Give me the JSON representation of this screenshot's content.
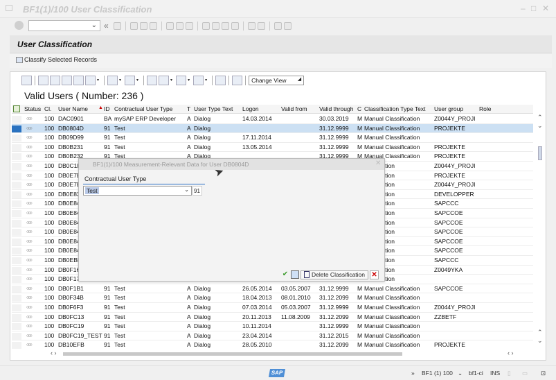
{
  "window": {
    "title": "BF1(1)/100 User Classification",
    "controls": [
      "‒",
      "□",
      "✕"
    ]
  },
  "command_field": {
    "value": ""
  },
  "page": {
    "title": "User Classification",
    "classify_button": "Classify Selected Records"
  },
  "alv": {
    "change_view": "Change View",
    "list_title": "Valid Users ( Number: 236 )"
  },
  "table": {
    "columns": [
      "Status",
      "Cl.",
      "User Name",
      "ID",
      "Contractual User Type",
      "T",
      "User Type Text",
      "Logon",
      "Valid from",
      "Valid through",
      "C",
      "Classification Type Text",
      "User group",
      "Role"
    ],
    "rows": [
      {
        "cl": "100",
        "user": "DAC0901",
        "id": "BA",
        "ctype": "mySAP ERP Developer",
        "t": "A",
        "ttext": "Dialog",
        "logon": "14.03.2014",
        "vfrom": "",
        "vthru": "30.03.2019",
        "c": "M",
        "ctext": "Manual Classification",
        "group": "Z0044Y_PROJI",
        "role": ""
      },
      {
        "cl": "100",
        "user": "DB0804D",
        "id": "91",
        "ctype": "Test",
        "t": "A",
        "ttext": "Dialog",
        "logon": "",
        "vfrom": "",
        "vthru": "31.12.9999",
        "c": "M",
        "ctext": "Manual Classification",
        "group": "PROJEKTE",
        "role": ""
      },
      {
        "cl": "100",
        "user": "DB09D99",
        "id": "91",
        "ctype": "Test",
        "t": "A",
        "ttext": "Dialog",
        "logon": "17.11.2014",
        "vfrom": "",
        "vthru": "31.12.9999",
        "c": "M",
        "ctext": "Manual Classification",
        "group": "",
        "role": ""
      },
      {
        "cl": "100",
        "user": "DB0B231",
        "id": "91",
        "ctype": "Test",
        "t": "A",
        "ttext": "Dialog",
        "logon": "13.05.2014",
        "vfrom": "",
        "vthru": "31.12.9999",
        "c": "M",
        "ctext": "Manual Classification",
        "group": "PROJEKTE",
        "role": ""
      },
      {
        "cl": "100",
        "user": "DB0B232",
        "id": "91",
        "ctype": "Test",
        "t": "A",
        "ttext": "Dialog",
        "logon": "",
        "vfrom": "",
        "vthru": "31.12.9999",
        "c": "M",
        "ctext": "Manual Classification",
        "group": "PROJEKTE",
        "role": ""
      },
      {
        "cl": "100",
        "user": "DB0C1E",
        "id": "",
        "ctype": "",
        "t": "",
        "ttext": "",
        "logon": "",
        "vfrom": "",
        "vthru": "",
        "c": "",
        "ctext": "lassification",
        "group": "Z0044Y_PROJI",
        "role": ""
      },
      {
        "cl": "100",
        "user": "DB0E7E",
        "id": "",
        "ctype": "",
        "t": "",
        "ttext": "",
        "logon": "",
        "vfrom": "",
        "vthru": "",
        "c": "",
        "ctext": "lassification",
        "group": "PROJEKTE",
        "role": ""
      },
      {
        "cl": "100",
        "user": "DB0E7E",
        "id": "",
        "ctype": "",
        "t": "",
        "ttext": "",
        "logon": "",
        "vfrom": "",
        "vthru": "",
        "c": "",
        "ctext": "lassification",
        "group": "Z0044Y_PROJI",
        "role": ""
      },
      {
        "cl": "100",
        "user": "DB0E83",
        "id": "",
        "ctype": "",
        "t": "",
        "ttext": "",
        "logon": "",
        "vfrom": "",
        "vthru": "",
        "c": "",
        "ctext": "lassification",
        "group": "DEVELOPPER",
        "role": ""
      },
      {
        "cl": "100",
        "user": "DB0E84",
        "id": "",
        "ctype": "",
        "t": "",
        "ttext": "",
        "logon": "",
        "vfrom": "",
        "vthru": "",
        "c": "",
        "ctext": "lassification",
        "group": "SAPCCC",
        "role": ""
      },
      {
        "cl": "100",
        "user": "DB0E84",
        "id": "",
        "ctype": "",
        "t": "",
        "ttext": "",
        "logon": "",
        "vfrom": "",
        "vthru": "",
        "c": "",
        "ctext": "lassification",
        "group": "SAPCCOE",
        "role": ""
      },
      {
        "cl": "100",
        "user": "DB0E84",
        "id": "",
        "ctype": "",
        "t": "",
        "ttext": "",
        "logon": "",
        "vfrom": "",
        "vthru": "",
        "c": "",
        "ctext": "lassification",
        "group": "SAPCCOE",
        "role": ""
      },
      {
        "cl": "100",
        "user": "DB0E84",
        "id": "",
        "ctype": "",
        "t": "",
        "ttext": "",
        "logon": "",
        "vfrom": "",
        "vthru": "",
        "c": "",
        "ctext": "lassification",
        "group": "SAPCCOE",
        "role": ""
      },
      {
        "cl": "100",
        "user": "DB0E84",
        "id": "",
        "ctype": "",
        "t": "",
        "ttext": "",
        "logon": "",
        "vfrom": "",
        "vthru": "",
        "c": "",
        "ctext": "lassification",
        "group": "SAPCCOE",
        "role": ""
      },
      {
        "cl": "100",
        "user": "DB0E84",
        "id": "",
        "ctype": "",
        "t": "",
        "ttext": "",
        "logon": "",
        "vfrom": "",
        "vthru": "",
        "c": "",
        "ctext": "lassification",
        "group": "SAPCCOE",
        "role": ""
      },
      {
        "cl": "100",
        "user": "DB0EBE",
        "id": "",
        "ctype": "",
        "t": "",
        "ttext": "",
        "logon": "",
        "vfrom": "",
        "vthru": "",
        "c": "",
        "ctext": "lassification",
        "group": "SAPCCC",
        "role": ""
      },
      {
        "cl": "100",
        "user": "DB0F16",
        "id": "",
        "ctype": "",
        "t": "",
        "ttext": "",
        "logon": "",
        "vfrom": "",
        "vthru": "",
        "c": "",
        "ctext": "lassification",
        "group": "Z0049YKA",
        "role": ""
      },
      {
        "cl": "100",
        "user": "DB0F17",
        "id": "",
        "ctype": "",
        "t": "",
        "ttext": "",
        "logon": "",
        "vfrom": "",
        "vthru": "",
        "c": "",
        "ctext": "lassification",
        "group": "",
        "role": ""
      },
      {
        "cl": "100",
        "user": "DB0F1B1",
        "id": "91",
        "ctype": "Test",
        "t": "A",
        "ttext": "Dialog",
        "logon": "26.05.2014",
        "vfrom": "03.05.2007",
        "vthru": "31.12.9999",
        "c": "M",
        "ctext": "Manual Classification",
        "group": "SAPCCOE",
        "role": ""
      },
      {
        "cl": "100",
        "user": "DB0F34B",
        "id": "91",
        "ctype": "Test",
        "t": "A",
        "ttext": "Dialog",
        "logon": "18.04.2013",
        "vfrom": "08.01.2010",
        "vthru": "31.12.2099",
        "c": "M",
        "ctext": "Manual Classification",
        "group": "",
        "role": ""
      },
      {
        "cl": "100",
        "user": "DB0F6F3",
        "id": "91",
        "ctype": "Test",
        "t": "A",
        "ttext": "Dialog",
        "logon": "07.03.2014",
        "vfrom": "05.03.2007",
        "vthru": "31.12.9999",
        "c": "M",
        "ctext": "Manual Classification",
        "group": "Z0044Y_PROJI",
        "role": ""
      },
      {
        "cl": "100",
        "user": "DB0FC13",
        "id": "91",
        "ctype": "Test",
        "t": "A",
        "ttext": "Dialog",
        "logon": "20.11.2013",
        "vfrom": "11.08.2009",
        "vthru": "31.12.2099",
        "c": "M",
        "ctext": "Manual Classification",
        "group": "ZZBETF",
        "role": ""
      },
      {
        "cl": "100",
        "user": "DB0FC19",
        "id": "91",
        "ctype": "Test",
        "t": "A",
        "ttext": "Dialog",
        "logon": "10.11.2014",
        "vfrom": "",
        "vthru": "31.12.9999",
        "c": "M",
        "ctext": "Manual Classification",
        "group": "",
        "role": ""
      },
      {
        "cl": "100",
        "user": "DB0FC19_TEST",
        "id": "91",
        "ctype": "Test",
        "t": "A",
        "ttext": "Dialog",
        "logon": "23.04.2014",
        "vfrom": "",
        "vthru": "31.12.2015",
        "c": "M",
        "ctext": "Manual Classification",
        "group": "",
        "role": ""
      },
      {
        "cl": "100",
        "user": "DB10EFB",
        "id": "91",
        "ctype": "Test",
        "t": "A",
        "ttext": "Dialog",
        "logon": "28.05.2010",
        "vfrom": "",
        "vthru": "31.12.2099",
        "c": "M",
        "ctext": "Manual Classification",
        "group": "PROJEKTE",
        "role": ""
      }
    ],
    "selected_row": 1
  },
  "dialog": {
    "title": "BF1(1)/100 Measurement-Relevant Data for User DB0804D",
    "group_label": "Contractual User Type",
    "select_value": "Test",
    "code_value": "91",
    "delete_label": "Delete Classification"
  },
  "statusbar": {
    "sap": "SAP",
    "system": "BF1 (1) 100",
    "server": "bf1-ci",
    "mode": "INS"
  }
}
